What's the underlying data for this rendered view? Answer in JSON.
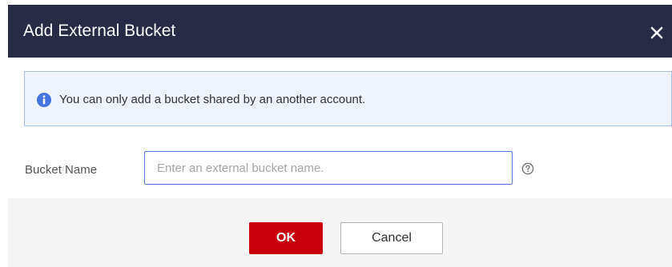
{
  "dialog": {
    "title": "Add External Bucket",
    "close_icon": "close-icon"
  },
  "notice": {
    "icon": "info-icon",
    "text": "You can only add a bucket shared by an another account."
  },
  "form": {
    "bucket_name_label": "Bucket Name",
    "bucket_name_value": "",
    "bucket_name_placeholder": "Enter an external bucket name.",
    "help_icon": "question-circle-icon"
  },
  "footer": {
    "ok_label": "OK",
    "cancel_label": "Cancel"
  },
  "colors": {
    "header_bg": "#272b45",
    "primary_button": "#c7000b",
    "notice_bg": "#eef3fd",
    "notice_border": "#a9c1f2",
    "info_icon": "#4674e0",
    "input_border": "#5878de"
  }
}
